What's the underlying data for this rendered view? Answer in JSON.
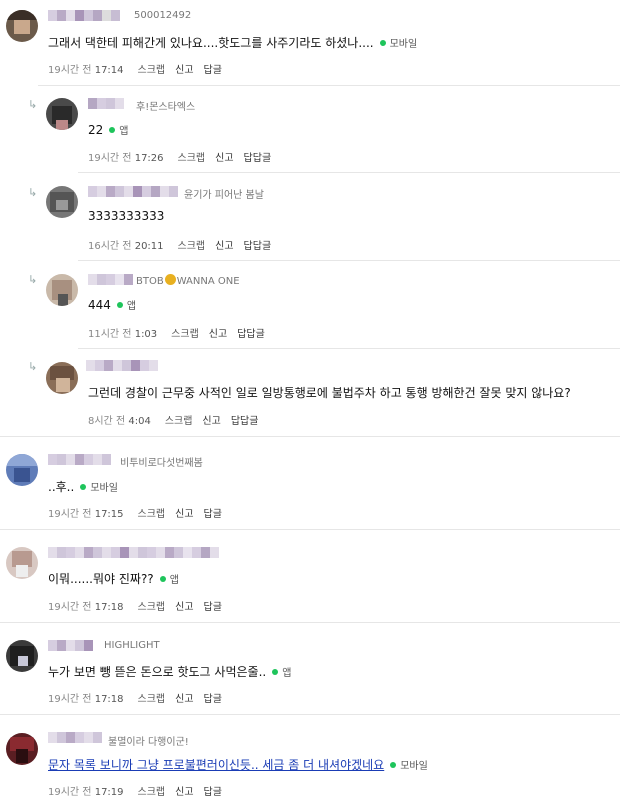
{
  "comments": [
    {
      "extra": "500012492",
      "text": "그래서 댁한테 피해간게 있나요....핫도그를 사주기라도 하셨나....",
      "device": "모바일",
      "time": "19시간 전",
      "clock": "17:14",
      "actions": [
        "스크랩",
        "신고",
        "답글"
      ]
    },
    {
      "extra": "후!몬스타엑스",
      "text": "22",
      "device": "앱",
      "time": "19시간 전",
      "clock": "17:26",
      "actions": [
        "스크랩",
        "신고",
        "답답글"
      ]
    },
    {
      "extra": "윤기가 피어난 봄날",
      "text": "3333333333",
      "device": "",
      "time": "16시간 전",
      "clock": "20:11",
      "actions": [
        "스크랩",
        "신고",
        "답답글"
      ]
    },
    {
      "extra_pre": "BTOB",
      "extra_post": "WANNA ONE",
      "text": "444",
      "device": "앱",
      "time": "11시간 전",
      "clock": "1:03",
      "actions": [
        "스크랩",
        "신고",
        "답답글"
      ]
    },
    {
      "extra": "",
      "text": "그런데 경찰이 근무중 사적인 일로 일방통행로에 불법주차 하고 통행 방해한건 잘못 맞지 않나요?",
      "device": "",
      "time": "8시간 전",
      "clock": "4:04",
      "actions": [
        "스크랩",
        "신고",
        "답답글"
      ]
    },
    {
      "extra": "비투비로다섯번째봄",
      "text": "..후..",
      "device": "모바일",
      "time": "19시간 전",
      "clock": "17:15",
      "actions": [
        "스크랩",
        "신고",
        "답글"
      ]
    },
    {
      "extra": "",
      "text": "이뭐......뭐야 진짜??",
      "device": "앱",
      "time": "19시간 전",
      "clock": "17:18",
      "actions": [
        "스크랩",
        "신고",
        "답글"
      ]
    },
    {
      "extra": "HIGHLIGHT",
      "text": "누가 보면 뺑 뜯은 돈으로 핫도그 사먹은줄..",
      "device": "앱",
      "time": "19시간 전",
      "clock": "17:18",
      "actions": [
        "스크랩",
        "신고",
        "답글"
      ]
    },
    {
      "extra": "불멸이라 다행이군!",
      "text": "문자 목록 보니까 그냥 프로불편러이신듯.. 세금 좀 더 내셔야겠네요",
      "device": "모바일",
      "time": "19시간 전",
      "clock": "17:19",
      "actions": [
        "스크랩",
        "신고",
        "답글"
      ]
    }
  ]
}
